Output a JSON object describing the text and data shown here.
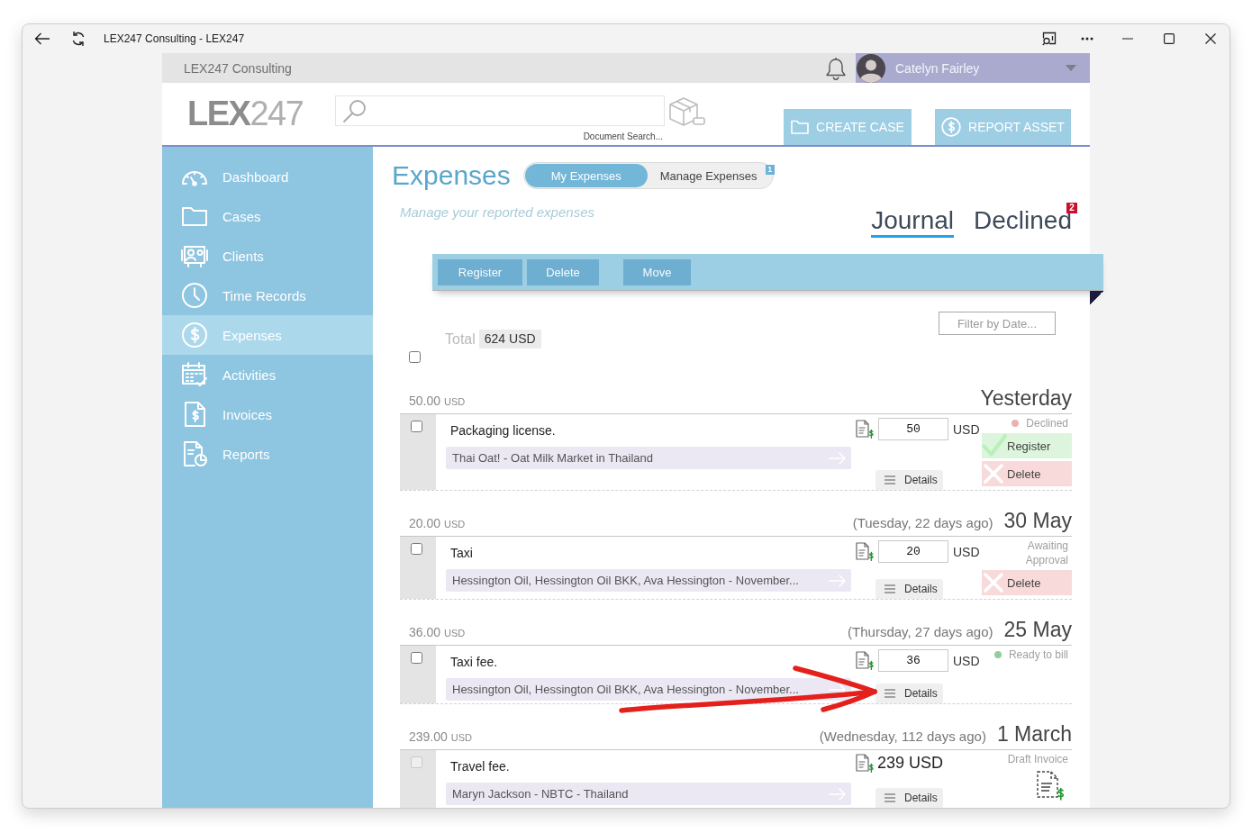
{
  "window": {
    "title": "LEX247 Consulting - LEX247"
  },
  "topbar": {
    "company": "LEX247 Consulting",
    "user": {
      "name": "Catelyn Fairley"
    }
  },
  "header": {
    "logo": "**LEX**247",
    "search": {
      "caption": "Document Search..."
    },
    "buttons": [
      {
        "kind": "create_case",
        "label": "CREATE CASE"
      },
      {
        "kind": "report_asset",
        "label": "REPORT ASSET"
      }
    ]
  },
  "sidebar": {
    "items": [
      {
        "kind": "dashboard",
        "label": "Dashboard",
        "selected": false
      },
      {
        "kind": "cases",
        "label": "Cases",
        "selected": false
      },
      {
        "kind": "clients",
        "label": "Clients",
        "selected": false
      },
      {
        "kind": "time_records",
        "label": "Time Records",
        "selected": false
      },
      {
        "kind": "expenses",
        "label": "Expenses",
        "selected": true
      },
      {
        "kind": "activities",
        "label": "Activities",
        "selected": false
      },
      {
        "kind": "invoices",
        "label": "Invoices",
        "selected": false
      },
      {
        "kind": "reports",
        "label": "Reports",
        "selected": false
      }
    ]
  },
  "page": {
    "title": "Expenses",
    "subtitle": "Manage your reported expenses",
    "scope_toggle": [
      {
        "label": "My Expenses",
        "selected": true
      },
      {
        "label": "Manage Expenses",
        "selected": false,
        "badge": "1"
      }
    ],
    "tabs": [
      {
        "label": "Journal",
        "selected": true
      },
      {
        "label": "Declined",
        "selected": false,
        "badge": "2"
      }
    ]
  },
  "toolbar": {
    "buttons": [
      {
        "kind": "register",
        "label": "Register",
        "disabled": true
      },
      {
        "kind": "delete",
        "label": "Delete",
        "disabled": true
      },
      {
        "kind": "move",
        "label": "Move",
        "disabled": true
      }
    ]
  },
  "filter": {
    "label": "Filter by Date..."
  },
  "total": {
    "label": "Total",
    "value": "624 USD"
  },
  "select_all": {
    "checked": false
  },
  "expenses": [
    {
      "amount": "50.00",
      "currency": "USD",
      "date": "Yesterday",
      "checked": false,
      "disabled": false,
      "title": "Packaging license.",
      "matter": "Thai Oat! - Oat Milk Market in Thailand",
      "price": {
        "kind": "input",
        "value": "50",
        "unit": "USD"
      },
      "status": {
        "kind": "dot",
        "label": "Declined",
        "color": "#e8b2b2"
      },
      "actions": [
        {
          "kind": "register",
          "label": "Register"
        },
        {
          "kind": "delete",
          "label": "Delete"
        }
      ],
      "details": "Details",
      "arrow_annotation": false
    },
    {
      "amount": "20.00",
      "currency": "USD",
      "relative_date": "(Tuesday, 22 days ago)",
      "date": "30 May",
      "checked": false,
      "disabled": false,
      "title": "Taxi",
      "matter": "Hessington Oil, Hessington Oil BKK, Ava Hessington - November...",
      "price": {
        "kind": "input",
        "value": "20",
        "unit": "USD"
      },
      "status": {
        "kind": "plain",
        "label": "Awaiting Approval"
      },
      "actions": [
        {
          "kind": "delete",
          "label": "Delete"
        }
      ],
      "details": "Details",
      "arrow_annotation": false
    },
    {
      "amount": "36.00",
      "currency": "USD",
      "relative_date": "(Thursday, 27 days ago)",
      "date": "25 May",
      "checked": false,
      "disabled": false,
      "title": "Taxi fee.",
      "matter": "Hessington Oil, Hessington Oil BKK, Ava Hessington - November...",
      "price": {
        "kind": "input",
        "value": "36",
        "unit": "USD"
      },
      "status": {
        "kind": "dot",
        "label": "Ready to bill",
        "color": "#92cf98"
      },
      "details": "Details",
      "arrow_annotation": true
    },
    {
      "amount": "239.00",
      "currency": "USD",
      "relative_date": "(Wednesday, 112 days ago)",
      "date": "1 March",
      "checked": false,
      "disabled": true,
      "title": "Travel fee.",
      "matter": "Maryn Jackson - NBTC - Thailand",
      "price": {
        "kind": "text",
        "value": "239 USD"
      },
      "status": {
        "kind": "invoice",
        "label": "Draft Invoice"
      },
      "details": "Details",
      "arrow_annotation": false
    }
  ]
}
